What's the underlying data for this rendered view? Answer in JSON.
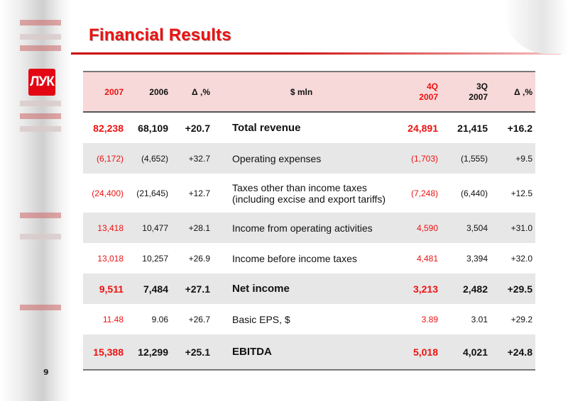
{
  "slide": {
    "title": "Financial Results",
    "page_number": "9",
    "logo_text": "ЛУК",
    "colors": {
      "accent": "#ee1111",
      "header_bg": "#f7d9d9",
      "row_shade": "#e7e7e7"
    }
  },
  "table": {
    "headers": [
      "2007",
      "2006",
      "Δ ,%",
      "$ mln",
      "4Q 2007",
      "3Q 2007",
      "Δ ,%"
    ],
    "header_lines": {
      "q4": [
        "4Q",
        "2007"
      ],
      "q3": [
        "3Q",
        "2007"
      ]
    },
    "rows": [
      {
        "label": "Total revenue",
        "y2007": "82,238",
        "y2006": "68,109",
        "dy": "+20.7",
        "q4": "24,891",
        "q3": "21,415",
        "dq": "+16.2",
        "bold": true
      },
      {
        "label": "Operating expenses",
        "y2007": "(6,172)",
        "y2006": "(4,652)",
        "dy": "+32.7",
        "q4": "(1,703)",
        "q3": "(1,555)",
        "dq": "+9.5",
        "bold": false
      },
      {
        "label": "Taxes other than income taxes (including excise and export tariffs)",
        "y2007": "(24,400)",
        "y2006": "(21,645)",
        "dy": "+12.7",
        "q4": "(7,248)",
        "q3": "(6,440)",
        "dq": "+12.5",
        "bold": false
      },
      {
        "label": "Income from operating activities",
        "y2007": "13,418",
        "y2006": "10,477",
        "dy": "+28.1",
        "q4": "4,590",
        "q3": "3,504",
        "dq": "+31.0",
        "bold": false
      },
      {
        "label": "Income before income taxes",
        "y2007": "13,018",
        "y2006": "10,257",
        "dy": "+26.9",
        "q4": "4,481",
        "q3": "3,394",
        "dq": "+32.0",
        "bold": false
      },
      {
        "label": "Net income",
        "y2007": "9,511",
        "y2006": "7,484",
        "dy": "+27.1",
        "q4": "3,213",
        "q3": "2,482",
        "dq": "+29.5",
        "bold": true
      },
      {
        "label": "Basic EPS, $",
        "y2007": "11.48",
        "y2006": "9.06",
        "dy": "+26.7",
        "q4": "3.89",
        "q3": "3.01",
        "dq": "+29.2",
        "bold": false
      },
      {
        "label": "EBITDA",
        "y2007": "15,388",
        "y2006": "12,299",
        "dy": "+25.1",
        "q4": "5,018",
        "q3": "4,021",
        "dq": "+24.8",
        "bold": true
      }
    ]
  }
}
